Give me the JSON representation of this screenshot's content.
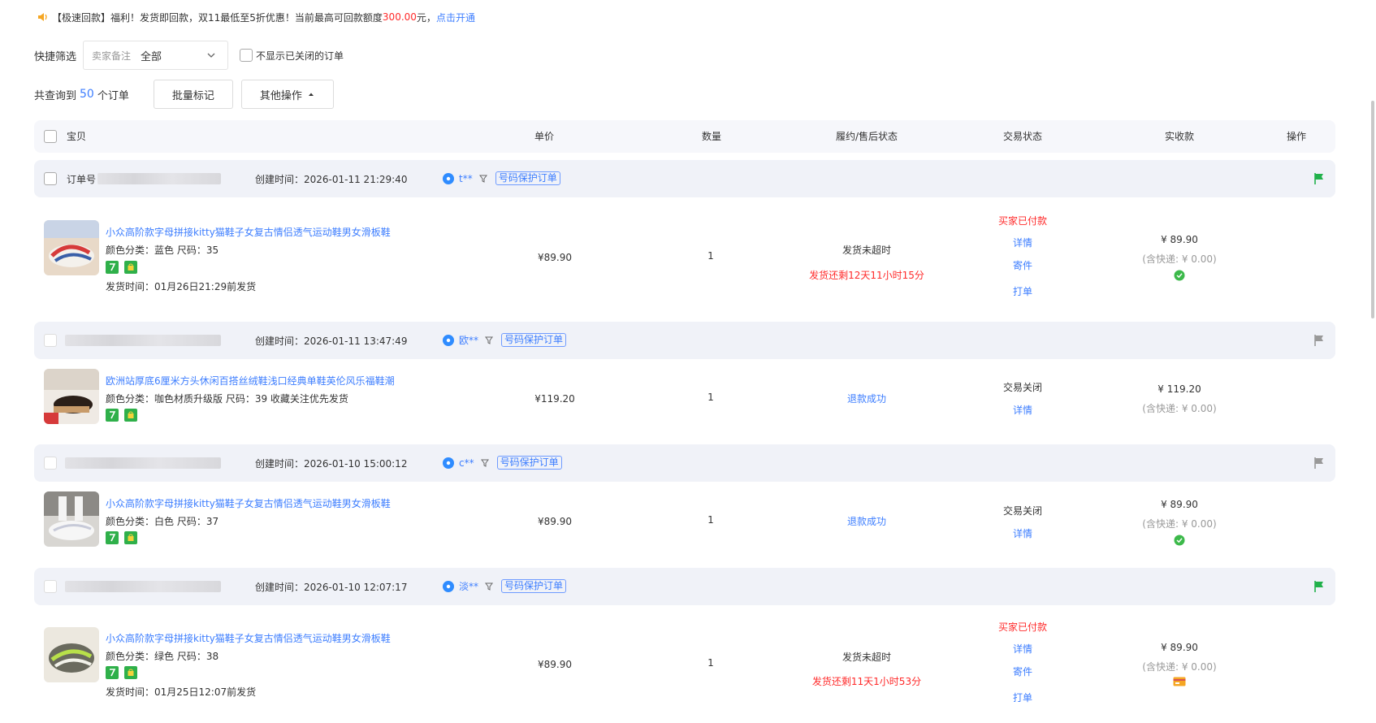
{
  "notice": {
    "prefix": "【极速回款】福利！发货即回款，双11最低至5折优惠！当前最高可回款额度",
    "amount": "300.00",
    "unit": "元，",
    "link": "点击开通"
  },
  "filter": {
    "label": "快捷筛选",
    "select_prefix": "卖家备注",
    "select_value": "全部",
    "hide_closed_label": "不显示已关闭的订单"
  },
  "summary": {
    "prefix": "共查询到",
    "count": "50",
    "suffix": "个订单",
    "batch_mark": "批量标记",
    "other_ops": "其他操作"
  },
  "columns": [
    "宝贝",
    "单价",
    "数量",
    "履约/售后状态",
    "交易状态",
    "实收款",
    "操作"
  ],
  "orders": [
    {
      "id_label": "订单号",
      "created": "创建时间：2026-01-11 21:29:40",
      "buyer": "t**",
      "tag": "号码保护订单",
      "flag_color": "#21b14b",
      "title": "小众高阶款字母拼接kitty猫鞋子女复古情侣透气运动鞋男女滑板鞋",
      "attr": "颜色分类：蓝色   尺码：35",
      "ship_time": "发货时间：01月26日21:29前发货",
      "price": "¥89.90",
      "qty": "1",
      "fulfil": "发货未超时",
      "fulfil_sub": "发货还剩12天11小时15分",
      "trade_status": "买家已付款",
      "actions": [
        "详情",
        "寄件",
        "打单"
      ],
      "paid": "¥ 89.90",
      "shipping": "(含快递: ¥ 0.00)",
      "pay_icon": "green-pay-icon"
    },
    {
      "id_label": "",
      "created": "创建时间：2026-01-11 13:47:49",
      "buyer": "欧**",
      "tag": "号码保护订单",
      "flag_color": "#999999",
      "title": "欧洲站厚底6厘米方头休闲百搭丝绒鞋浅口经典单鞋英伦风乐福鞋潮",
      "attr": "颜色分类：咖色材质升级版   尺码：39 收藏关注优先发货",
      "ship_time": "",
      "price": "¥119.20",
      "qty": "1",
      "fulfil": "退款成功",
      "fulfil_sub": "",
      "trade_status": "交易关闭",
      "actions": [
        "详情"
      ],
      "paid": "¥ 119.20",
      "shipping": "(含快递: ¥ 0.00)",
      "pay_icon": ""
    },
    {
      "id_label": "",
      "created": "创建时间：2026-01-10 15:00:12",
      "buyer": "c**",
      "tag": "号码保护订单",
      "flag_color": "#999999",
      "title": "小众高阶款字母拼接kitty猫鞋子女复古情侣透气运动鞋男女滑板鞋",
      "attr": "颜色分类：白色   尺码：37",
      "ship_time": "",
      "price": "¥89.90",
      "qty": "1",
      "fulfil": "退款成功",
      "fulfil_sub": "",
      "trade_status": "交易关闭",
      "actions": [
        "详情"
      ],
      "paid": "¥ 89.90",
      "shipping": "(含快递: ¥ 0.00)",
      "pay_icon": "green-pay-icon"
    },
    {
      "id_label": "",
      "created": "创建时间：2026-01-10 12:07:17",
      "buyer": "淡**",
      "tag": "号码保护订单",
      "flag_color": "#21b14b",
      "title": "小众高阶款字母拼接kitty猫鞋子女复古情侣透气运动鞋男女滑板鞋",
      "attr": "颜色分类：绿色   尺码：38",
      "ship_time": "发货时间：01月25日12:07前发货",
      "price": "¥89.90",
      "qty": "1",
      "fulfil": "发货未超时",
      "fulfil_sub": "发货还剩11天1小时53分",
      "trade_status": "买家已付款",
      "actions": [
        "详情",
        "寄件",
        "打单"
      ],
      "paid": "¥ 89.90",
      "shipping": "(含快递: ¥ 0.00)",
      "pay_icon": "card-pay-icon"
    }
  ]
}
